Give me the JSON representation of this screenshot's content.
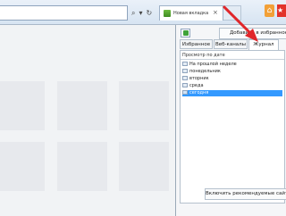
{
  "toolbar": {
    "search_refresh": [
      "⌕",
      "▾",
      "↻"
    ],
    "tab": {
      "label": "Новая вкладка",
      "close": "×"
    }
  },
  "panel": {
    "add_favorites_label": "Добавить в избранное",
    "tabs": [
      {
        "label": "Избранное"
      },
      {
        "label": "Веб-каналы"
      },
      {
        "label": "Журнал"
      }
    ],
    "active_tab": "Журнал",
    "view_label": "Просмотр по дате",
    "history_items": [
      {
        "label": "На прошлой неделе"
      },
      {
        "label": "понедельник"
      },
      {
        "label": "вторник"
      },
      {
        "label": "среда"
      },
      {
        "label": "сегодня"
      }
    ],
    "selected_item": "сегодня",
    "suggest_button": "Включить рекомендуемые сайты"
  },
  "colors": {
    "accent": "#3399ff",
    "annotation_arrow": "#e0262a"
  },
  "icons": [
    "back-arrow-icon",
    "search-icon",
    "refresh-icon",
    "new-tab-favicon",
    "home-icon",
    "favorites-star-icon",
    "pin-icon",
    "history-folder-icon"
  ]
}
